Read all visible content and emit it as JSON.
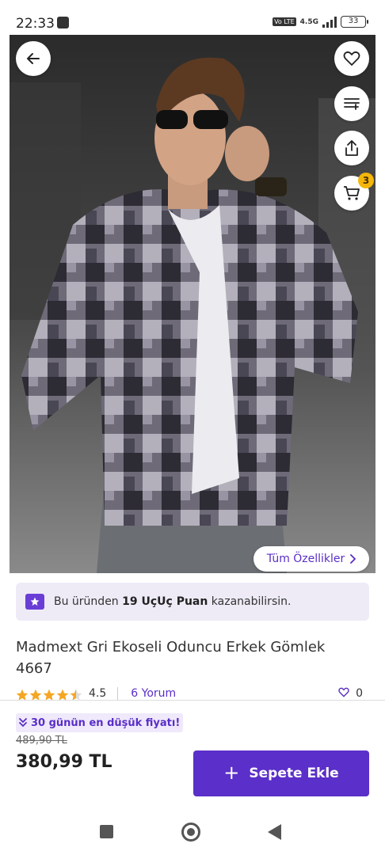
{
  "status_bar": {
    "time": "22:33",
    "network": "4.5G",
    "volte_label": "Vo LTE",
    "battery": "33"
  },
  "hero": {
    "icons": [
      "back-arrow-icon",
      "heart-icon",
      "variant-list-icon",
      "share-icon",
      "cart-icon"
    ],
    "cart_count": "3",
    "features_label": "Tüm Özellikler"
  },
  "points_banner": {
    "prefix": "Bu üründen ",
    "points": "19 UçUç Puan",
    "suffix": " kazanabilirsin."
  },
  "product": {
    "title": "Madmext Gri Ekoseli Oduncu Erkek Gömlek 4667",
    "rating": "4.5",
    "reviews": "6 Yorum",
    "likes": "0"
  },
  "purchase": {
    "lowest_badge": "30 günün en düşük fiyatı!",
    "old_price": "489,90 TL",
    "price": "380,99 TL",
    "add_to_cart": "Sepete Ekle"
  },
  "colors": {
    "accent": "#5b2fc9",
    "badge": "#f5b60b",
    "banner_bg": "#eeebf7",
    "star": "#f5a623"
  }
}
